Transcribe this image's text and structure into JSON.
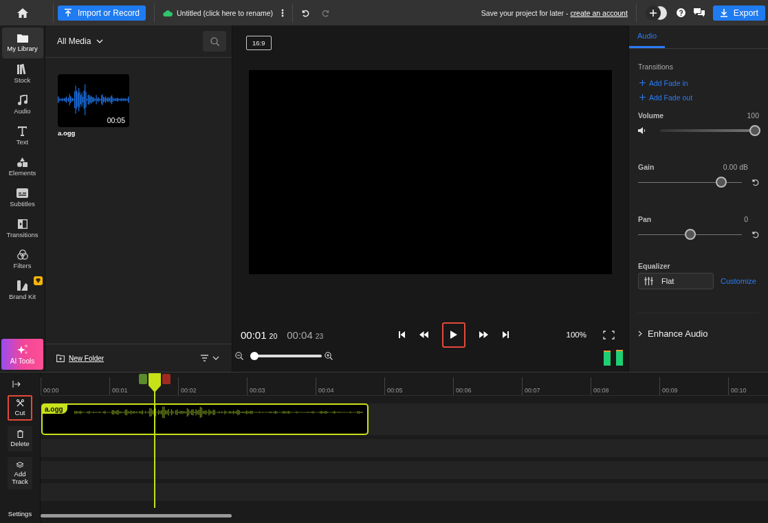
{
  "top_bar": {
    "import_button": "Import or Record",
    "project_title": "Untitled (click here to rename)",
    "save_prompt": "Save your project for later - ",
    "account_link": "create an account",
    "export_button": "Export"
  },
  "sidebar": {
    "items": [
      {
        "label": "My Library",
        "kind": "library",
        "selected": true,
        "premium": false
      },
      {
        "label": "Stock",
        "kind": "stock",
        "selected": false,
        "premium": false
      },
      {
        "label": "Audio",
        "kind": "audio",
        "selected": false,
        "premium": false
      },
      {
        "label": "Text",
        "kind": "text",
        "selected": false,
        "premium": false
      },
      {
        "label": "Elements",
        "kind": "elements",
        "selected": false,
        "premium": false
      },
      {
        "label": "Subtitles",
        "kind": "subtitles",
        "selected": false,
        "premium": false
      },
      {
        "label": "Transitions",
        "kind": "transitions",
        "selected": false,
        "premium": false
      },
      {
        "label": "Filters",
        "kind": "filters",
        "selected": false,
        "premium": false
      },
      {
        "label": "Brand Kit",
        "kind": "brand",
        "selected": false,
        "premium": true
      }
    ],
    "ai_button": "AI Tools"
  },
  "media_panel": {
    "filter": "All Media",
    "items": [
      {
        "name": "a.ogg",
        "duration": "00:05"
      }
    ],
    "new_folder": "New Folder"
  },
  "preview": {
    "aspect_ratio": "16:9",
    "current_time": "00:01",
    "current_frames": "20",
    "total_time": "00:04",
    "total_frames": "23",
    "zoom_percent": "100%",
    "play_highlighted": true,
    "zoom_slider": {
      "level": 0.05
    },
    "meters": [
      {
        "level": 0.93
      },
      {
        "level": 0.95
      }
    ]
  },
  "properties": {
    "tabs": [
      {
        "label": "Audio",
        "selected": true
      }
    ],
    "transitions_title": "Transitions",
    "transition_actions": [
      "Add Fade in",
      "Add Fade out"
    ],
    "sliders": [
      {
        "label": "Volume",
        "reading": "100",
        "level": 1,
        "kind": "volume"
      },
      {
        "label": "Gain",
        "reading": "0.00 dB",
        "level": 0.84,
        "kind": "reset"
      },
      {
        "label": "Pan",
        "reading": "0",
        "level": 0.5,
        "kind": "reset"
      }
    ],
    "equalizer": {
      "title": "Equalizer",
      "preset": "Flat",
      "action": "Customize"
    },
    "sections": [
      {
        "title": "Enhance Audio",
        "expanded": false
      }
    ]
  },
  "timeline": {
    "tools": [
      {
        "label": "Cut",
        "kind": "cut",
        "highlighted": true
      },
      {
        "label": "Delete",
        "kind": "delete",
        "highlighted": false
      },
      {
        "label": "Add Track",
        "kind": "add-track",
        "highlighted": false
      }
    ],
    "settings": "Settings",
    "ruler": [
      "00:00",
      "00:01",
      "00:02",
      "00:03",
      "00:04",
      "00:05",
      "00:06",
      "00:07",
      "00:08",
      "00:09",
      "00:10"
    ],
    "playhead": {
      "level": 0.157
    },
    "clips": [
      {
        "name": "a.ogg"
      }
    ]
  }
}
